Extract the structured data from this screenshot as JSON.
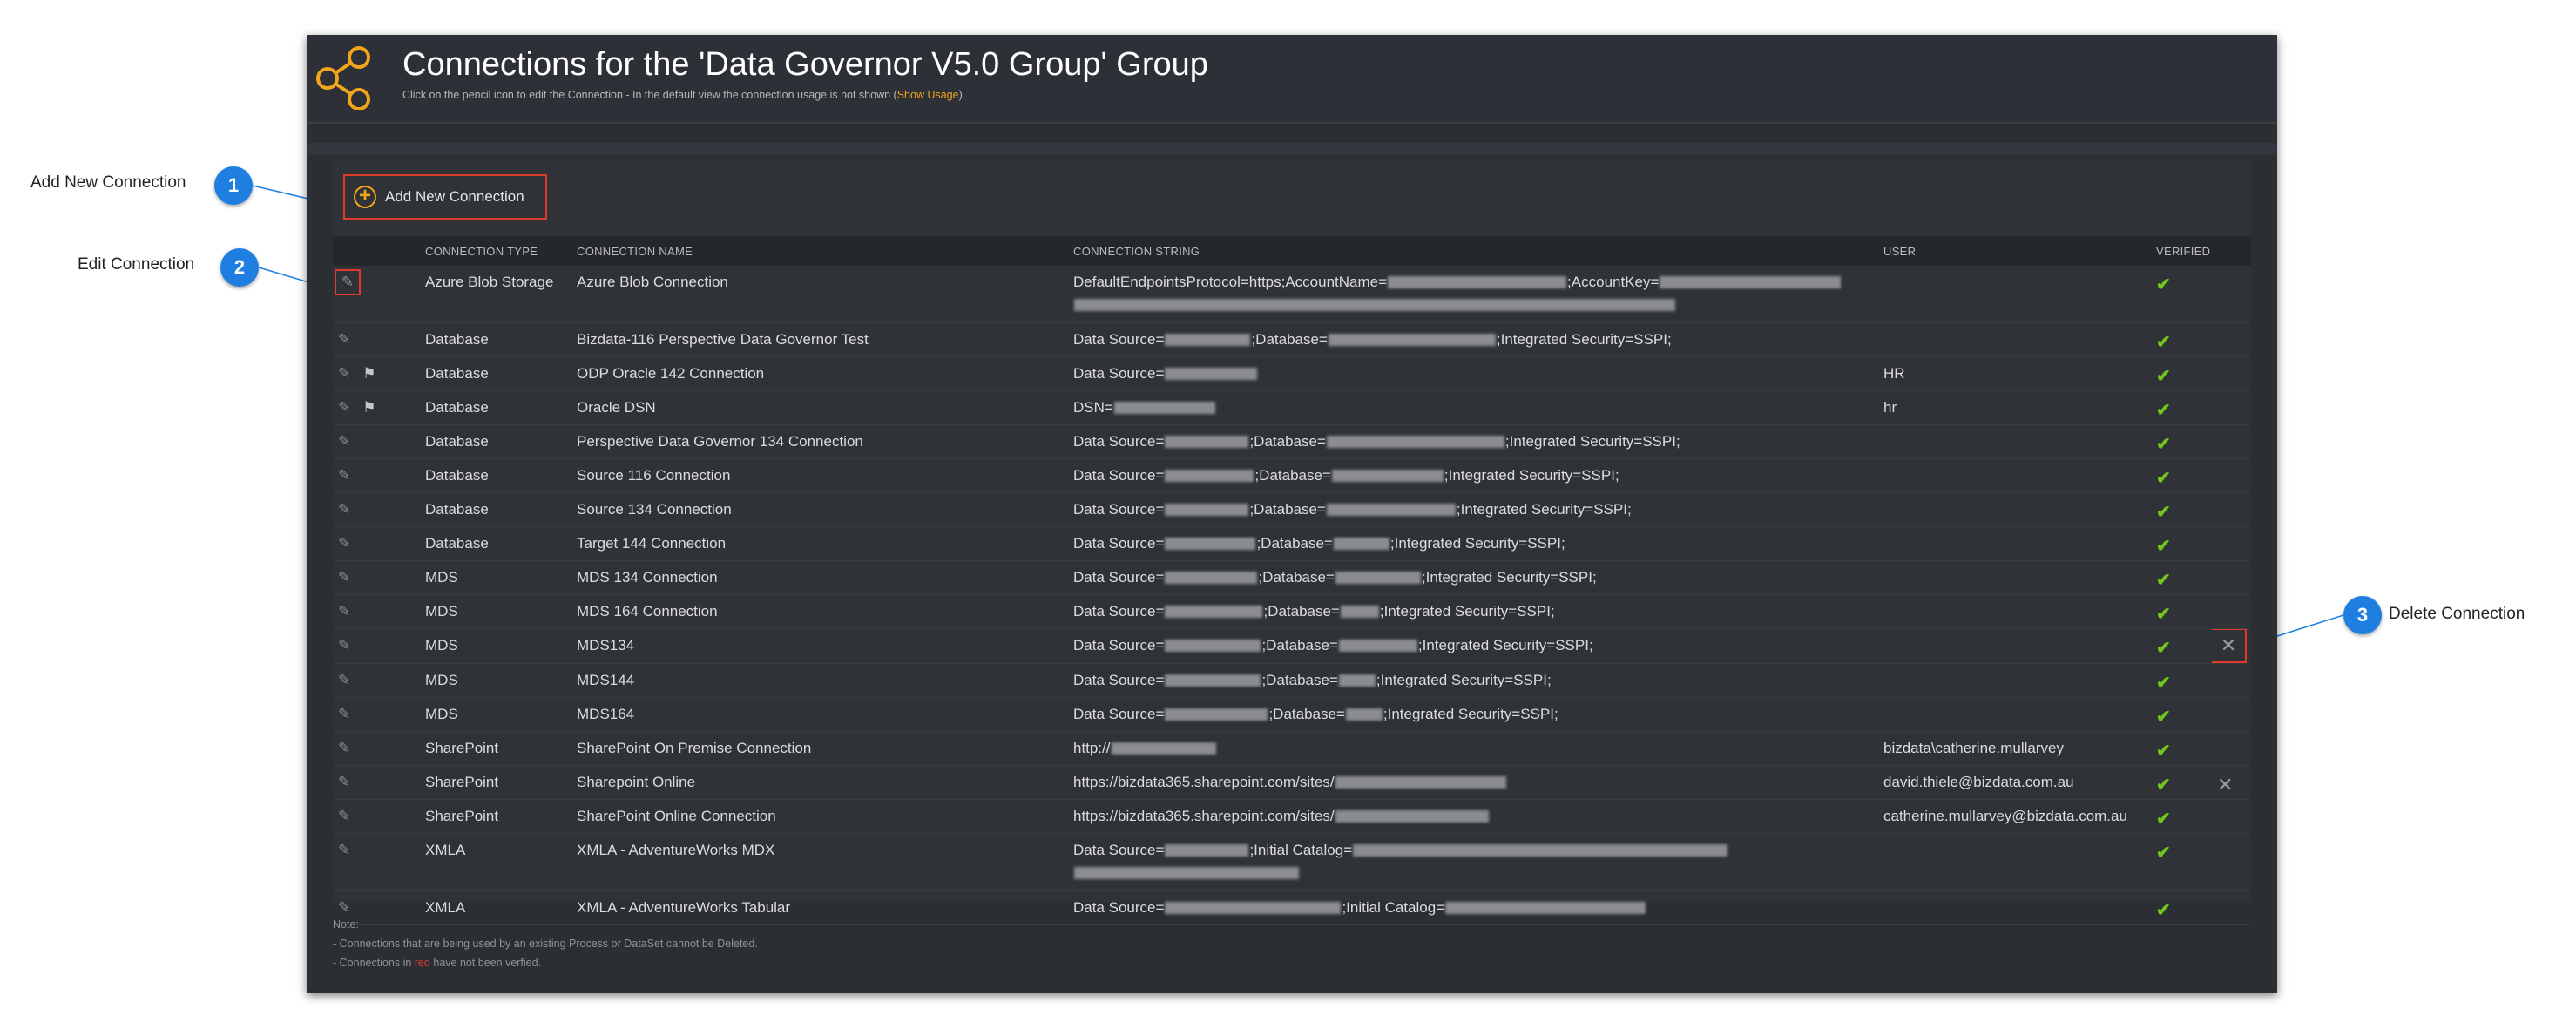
{
  "callouts": [
    {
      "number": "1",
      "label": "Add New Connection"
    },
    {
      "number": "2",
      "label": "Edit Connection"
    },
    {
      "number": "3",
      "label": "Delete Connection"
    }
  ],
  "header": {
    "title": "Connections for the 'Data Governor V5.0 Group' Group",
    "subtitle_text": "Click on the pencil icon to edit the Connection - In the default view the connection usage is not shown (",
    "show_usage_link": "Show Usage",
    "subtitle_close": ")"
  },
  "toolbar": {
    "add_label": "Add New Connection"
  },
  "columns": [
    "CONNECTION TYPE",
    "CONNECTION NAME",
    "CONNECTION STRING",
    "USER",
    "VERIFIED"
  ],
  "icons": {
    "edit": "pencil-icon",
    "flag": "flag-icon",
    "verified": "check-icon",
    "delete": "close-icon",
    "logo": "share-icon",
    "add": "plus-circle-icon"
  },
  "colors": {
    "accent": "#f2a51a",
    "highlight": "#e0392e",
    "verified": "#71c71b",
    "callout": "#1e7fe0"
  },
  "rows": [
    {
      "type": "Azure Blob Storage",
      "name": "Azure Blob Connection",
      "cs_parts": [
        "DefaultEndpointsProtocol=https;AccountName=",
        "",
        ";AccountKey=",
        ""
      ],
      "cs_line2": "",
      "user": ""
    },
    {
      "type": "Database",
      "name": "Bizdata-116 Perspective Data Governor Test",
      "cs_parts": [
        "Data Source=",
        "",
        ";Database=",
        "",
        ";Integrated Security=SSPI;"
      ],
      "user": ""
    },
    {
      "type": "Database",
      "name": "ODP Oracle 142 Connection",
      "cs_parts": [
        "Data Source=",
        ""
      ],
      "user": "HR"
    },
    {
      "type": "Database",
      "name": "Oracle DSN",
      "cs_parts": [
        "DSN=",
        ""
      ],
      "user": "hr"
    },
    {
      "type": "Database",
      "name": "Perspective Data Governor 134 Connection",
      "cs_parts": [
        "Data Source=",
        "",
        ";Database=",
        "",
        ";Integrated Security=SSPI;"
      ],
      "user": ""
    },
    {
      "type": "Database",
      "name": "Source 116 Connection",
      "cs_parts": [
        "Data Source=",
        "",
        ";Database=",
        "",
        ";Integrated Security=SSPI;"
      ],
      "user": ""
    },
    {
      "type": "Database",
      "name": "Source 134 Connection",
      "cs_parts": [
        "Data Source=",
        "",
        ";Database=",
        "",
        ";Integrated Security=SSPI;"
      ],
      "user": ""
    },
    {
      "type": "Database",
      "name": "Target 144 Connection",
      "cs_parts": [
        "Data Source=",
        "",
        ";Database=",
        "",
        ";Integrated Security=SSPI;"
      ],
      "user": ""
    },
    {
      "type": "MDS",
      "name": "MDS 134 Connection",
      "cs_parts": [
        "Data Source=",
        "",
        ";Database=",
        "",
        ";Integrated Security=SSPI;"
      ],
      "user": ""
    },
    {
      "type": "MDS",
      "name": "MDS 164 Connection",
      "cs_parts": [
        "Data Source=",
        "",
        ";Database=",
        "",
        ";Integrated Security=SSPI;"
      ],
      "user": ""
    },
    {
      "type": "MDS",
      "name": "MDS134",
      "cs_parts": [
        "Data Source=",
        "",
        ";Database=",
        "",
        ";Integrated Security=SSPI;"
      ],
      "user": ""
    },
    {
      "type": "MDS",
      "name": "MDS144",
      "cs_parts": [
        "Data Source=",
        "",
        ";Database=",
        "",
        ";Integrated Security=SSPI;"
      ],
      "user": ""
    },
    {
      "type": "MDS",
      "name": "MDS164",
      "cs_parts": [
        "Data Source=",
        "",
        ";Database=",
        "",
        ";Integrated Security=SSPI;"
      ],
      "user": ""
    },
    {
      "type": "SharePoint",
      "name": "SharePoint On Premise Connection",
      "cs_parts": [
        "http://",
        ""
      ],
      "user": "bizdata\\catherine.mullarvey"
    },
    {
      "type": "SharePoint",
      "name": "Sharepoint Online",
      "cs_parts": [
        "https://bizdata365.sharepoint.com/sites/",
        ""
      ],
      "user": "david.thiele@bizdata.com.au"
    },
    {
      "type": "SharePoint",
      "name": "SharePoint Online Connection",
      "cs_parts": [
        "https://bizdata365.sharepoint.com/sites/",
        ""
      ],
      "user": "catherine.mullarvey@bizdata.com.au"
    },
    {
      "type": "XMLA",
      "name": "XMLA - AdventureWorks MDX",
      "cs_parts": [
        "Data Source=",
        "",
        ";Initial Catalog=",
        ""
      ],
      "cs_line2": "",
      "user": ""
    },
    {
      "type": "XMLA",
      "name": "XMLA - AdventureWorks Tabular",
      "cs_parts": [
        "Data Source=",
        "",
        ";Initial Catalog=",
        ""
      ],
      "user": ""
    }
  ],
  "notes": {
    "title": "Note:",
    "line1": "- Connections that are being used by an existing Process or DataSet cannot be Deleted.",
    "line2_pre": "- Connections in ",
    "line2_red": "red",
    "line2_post": " have not been verfied."
  }
}
